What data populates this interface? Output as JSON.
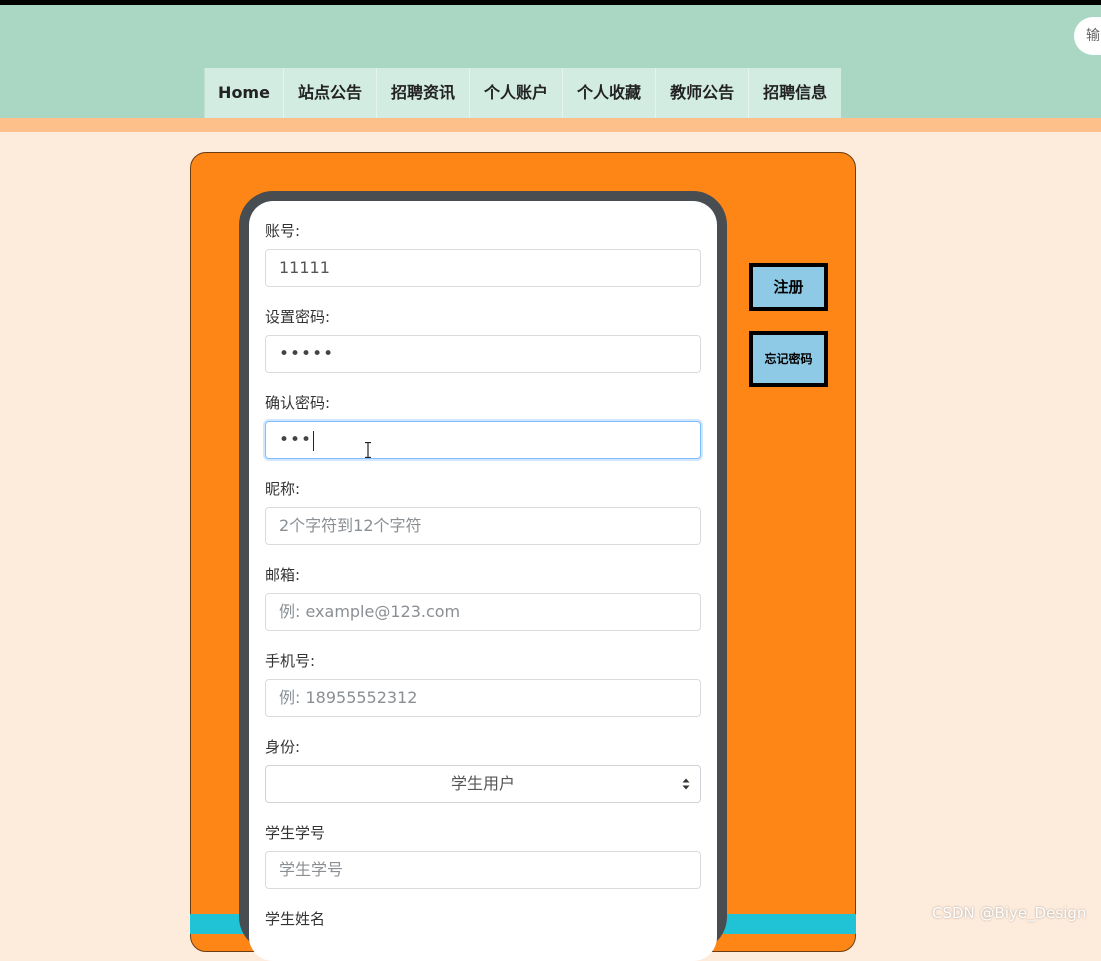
{
  "search": {
    "placeholder_fragment": "输"
  },
  "nav": {
    "items": [
      {
        "label": "Home"
      },
      {
        "label": "站点公告"
      },
      {
        "label": "招聘资讯"
      },
      {
        "label": "个人账户"
      },
      {
        "label": "个人收藏"
      },
      {
        "label": "教师公告"
      },
      {
        "label": "招聘信息"
      }
    ]
  },
  "form": {
    "account": {
      "label": "账号:",
      "value": "11111"
    },
    "password": {
      "label": "设置密码:",
      "value": "•••••"
    },
    "confirm_password": {
      "label": "确认密码:",
      "value": "•••"
    },
    "nickname": {
      "label": "昵称:",
      "placeholder": "2个字符到12个字符"
    },
    "email": {
      "label": "邮箱:",
      "placeholder": "例: example@123.com"
    },
    "phone": {
      "label": "手机号:",
      "placeholder": "例: 18955552312"
    },
    "role": {
      "label": "身份:",
      "selected": "学生用户"
    },
    "student_id": {
      "label": "学生学号",
      "placeholder": "学生学号"
    },
    "student_name": {
      "label": "学生姓名"
    }
  },
  "actions": {
    "register_label": "注册",
    "forgot_label": "忘记密码"
  },
  "watermark": "CSDN @Biye_Design"
}
